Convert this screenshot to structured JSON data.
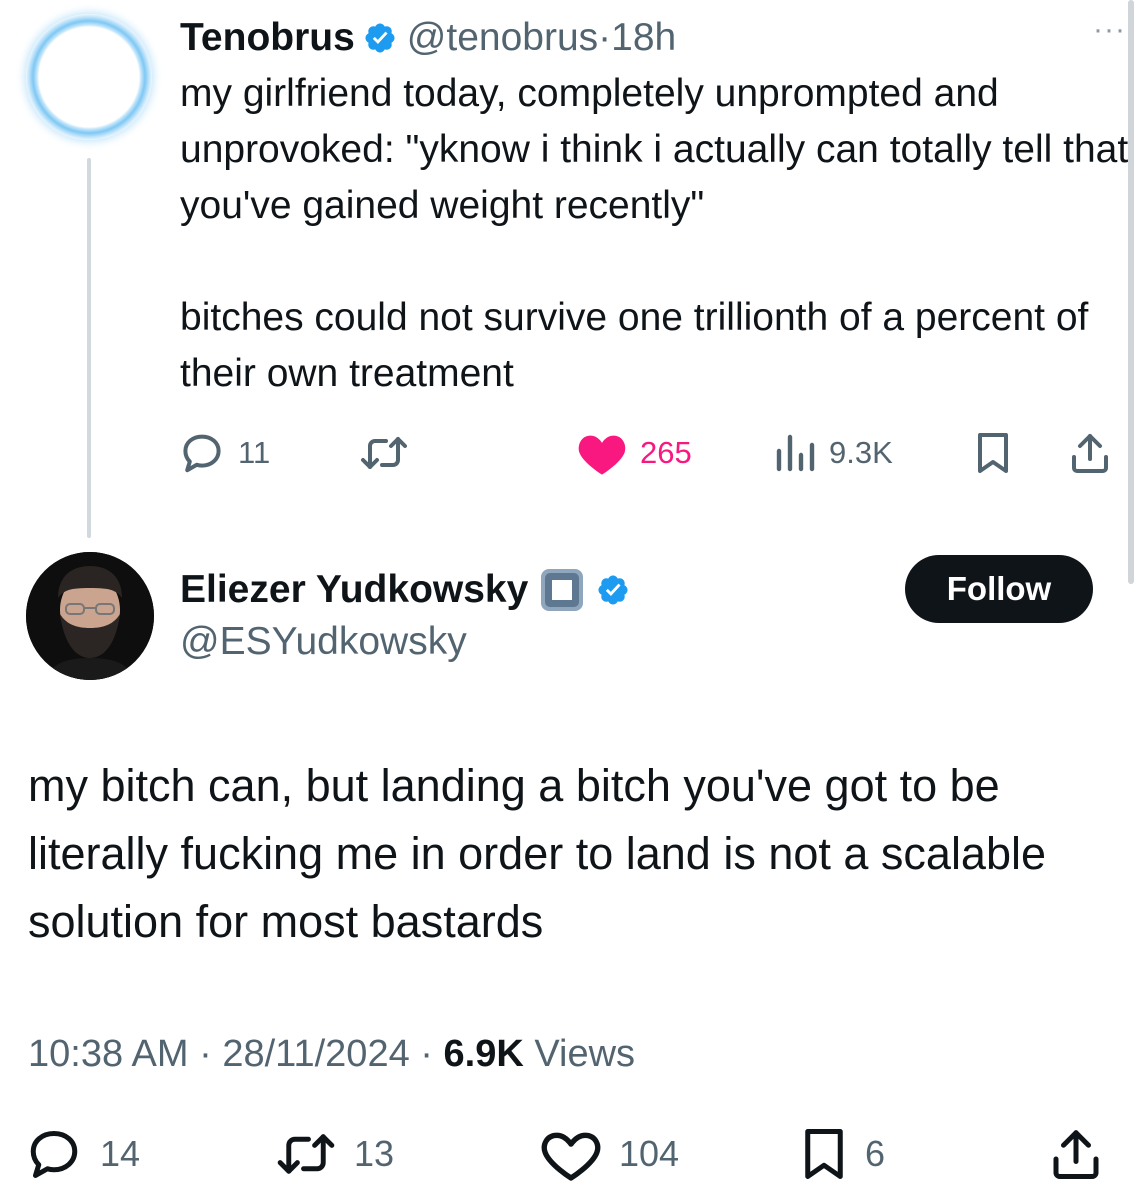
{
  "parent_tweet": {
    "display_name": "Tenobrus",
    "handle": "@tenobrus",
    "separator": "·",
    "time": "18h",
    "verified_icon": "verified-badge-icon",
    "more_icon": "more-dots-icon",
    "text_para1": "my girlfriend today, completely unprompted and unprovoked: \"yknow i think i actually can totally tell that you've gained weight recently\"",
    "text_para2": "bitches  could not survive one trillionth of a percent of their own treatment",
    "actions": {
      "replies": "11",
      "reposts": "",
      "likes": "265",
      "views": "9.3K"
    },
    "like_color": "#f91880"
  },
  "main_tweet": {
    "display_name": "Eliezer Yudkowsky",
    "handle": "@ESYudkowsky",
    "follow_label": "Follow",
    "text": "my bitch can, but landing a bitch you've got to be literally fucking me in order to land is not a scalable solution for most bastards",
    "time": "10:38 AM",
    "date": "28/11/2024",
    "views_count": "6.9K",
    "views_label": "Views",
    "meta_separator": "·",
    "actions": {
      "replies": "14",
      "reposts": "13",
      "likes": "104",
      "bookmarks": "6"
    }
  },
  "colors": {
    "text_primary": "#0f1419",
    "text_secondary": "#536471",
    "verified_blue": "#1d9bf0",
    "follow_bg": "#0f1419"
  }
}
